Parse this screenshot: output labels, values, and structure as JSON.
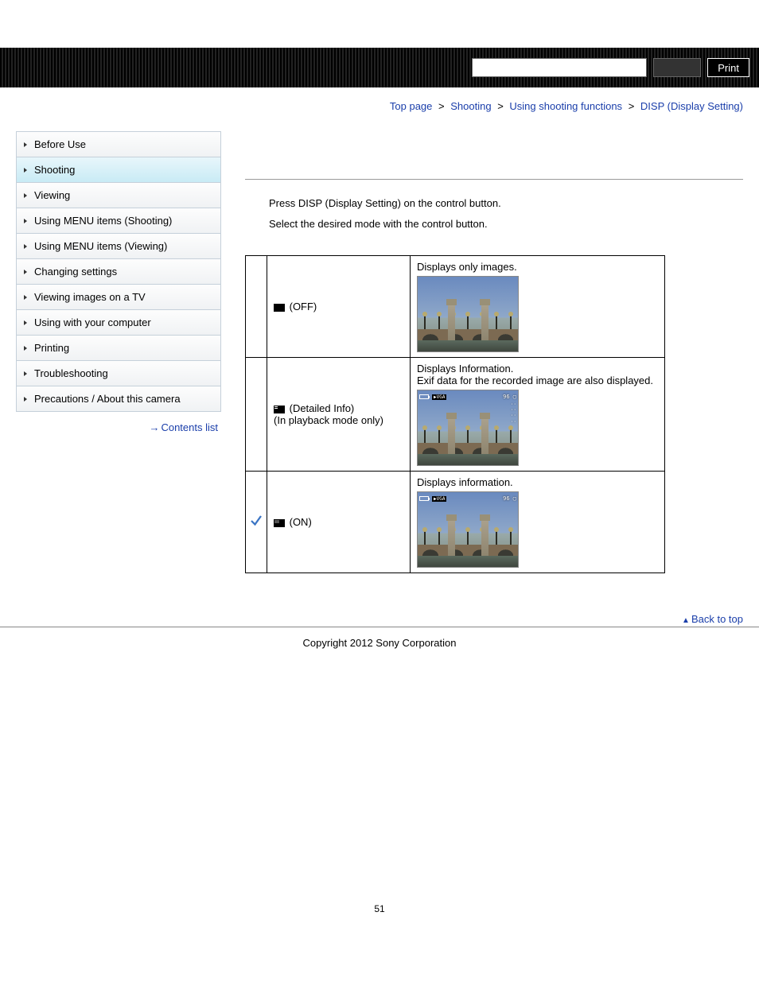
{
  "header": {
    "print_label": "Print"
  },
  "breadcrumb": {
    "items": [
      "Top page",
      "Shooting",
      "Using shooting functions"
    ],
    "current": "DISP (Display Setting)"
  },
  "sidebar": {
    "items": [
      "Before Use",
      "Shooting",
      "Viewing",
      "Using MENU items (Shooting)",
      "Using MENU items (Viewing)",
      "Changing settings",
      "Viewing images on a TV",
      "Using with your computer",
      "Printing",
      "Troubleshooting",
      "Precautions / About this camera"
    ],
    "active_index": 1,
    "contents_link": "Contents list"
  },
  "main": {
    "instruction_1": "Press DISP (Display Setting) on the control button.",
    "instruction_2": "Select the desired mode with the control button.",
    "rows": [
      {
        "checked": false,
        "label": "(OFF)",
        "sublabel": "",
        "desc_line1": "Displays only images.",
        "desc_line2": "",
        "overlay": false
      },
      {
        "checked": false,
        "label": "(Detailed Info)",
        "sublabel": "(In playback mode only)",
        "desc_line1": "Displays Information.",
        "desc_line2": "Exif data for the recorded image are also displayed.",
        "overlay": true,
        "overlay_extra": true
      },
      {
        "checked": true,
        "label": "(ON)",
        "sublabel": "",
        "desc_line1": "Displays information.",
        "desc_line2": "",
        "overlay": true,
        "overlay_extra": false
      }
    ],
    "overlay_text": {
      "vga": "VGA",
      "count": "96"
    }
  },
  "footer": {
    "back_to_top": "Back to top",
    "copyright": "Copyright 2012 Sony Corporation",
    "page_number": "51"
  }
}
